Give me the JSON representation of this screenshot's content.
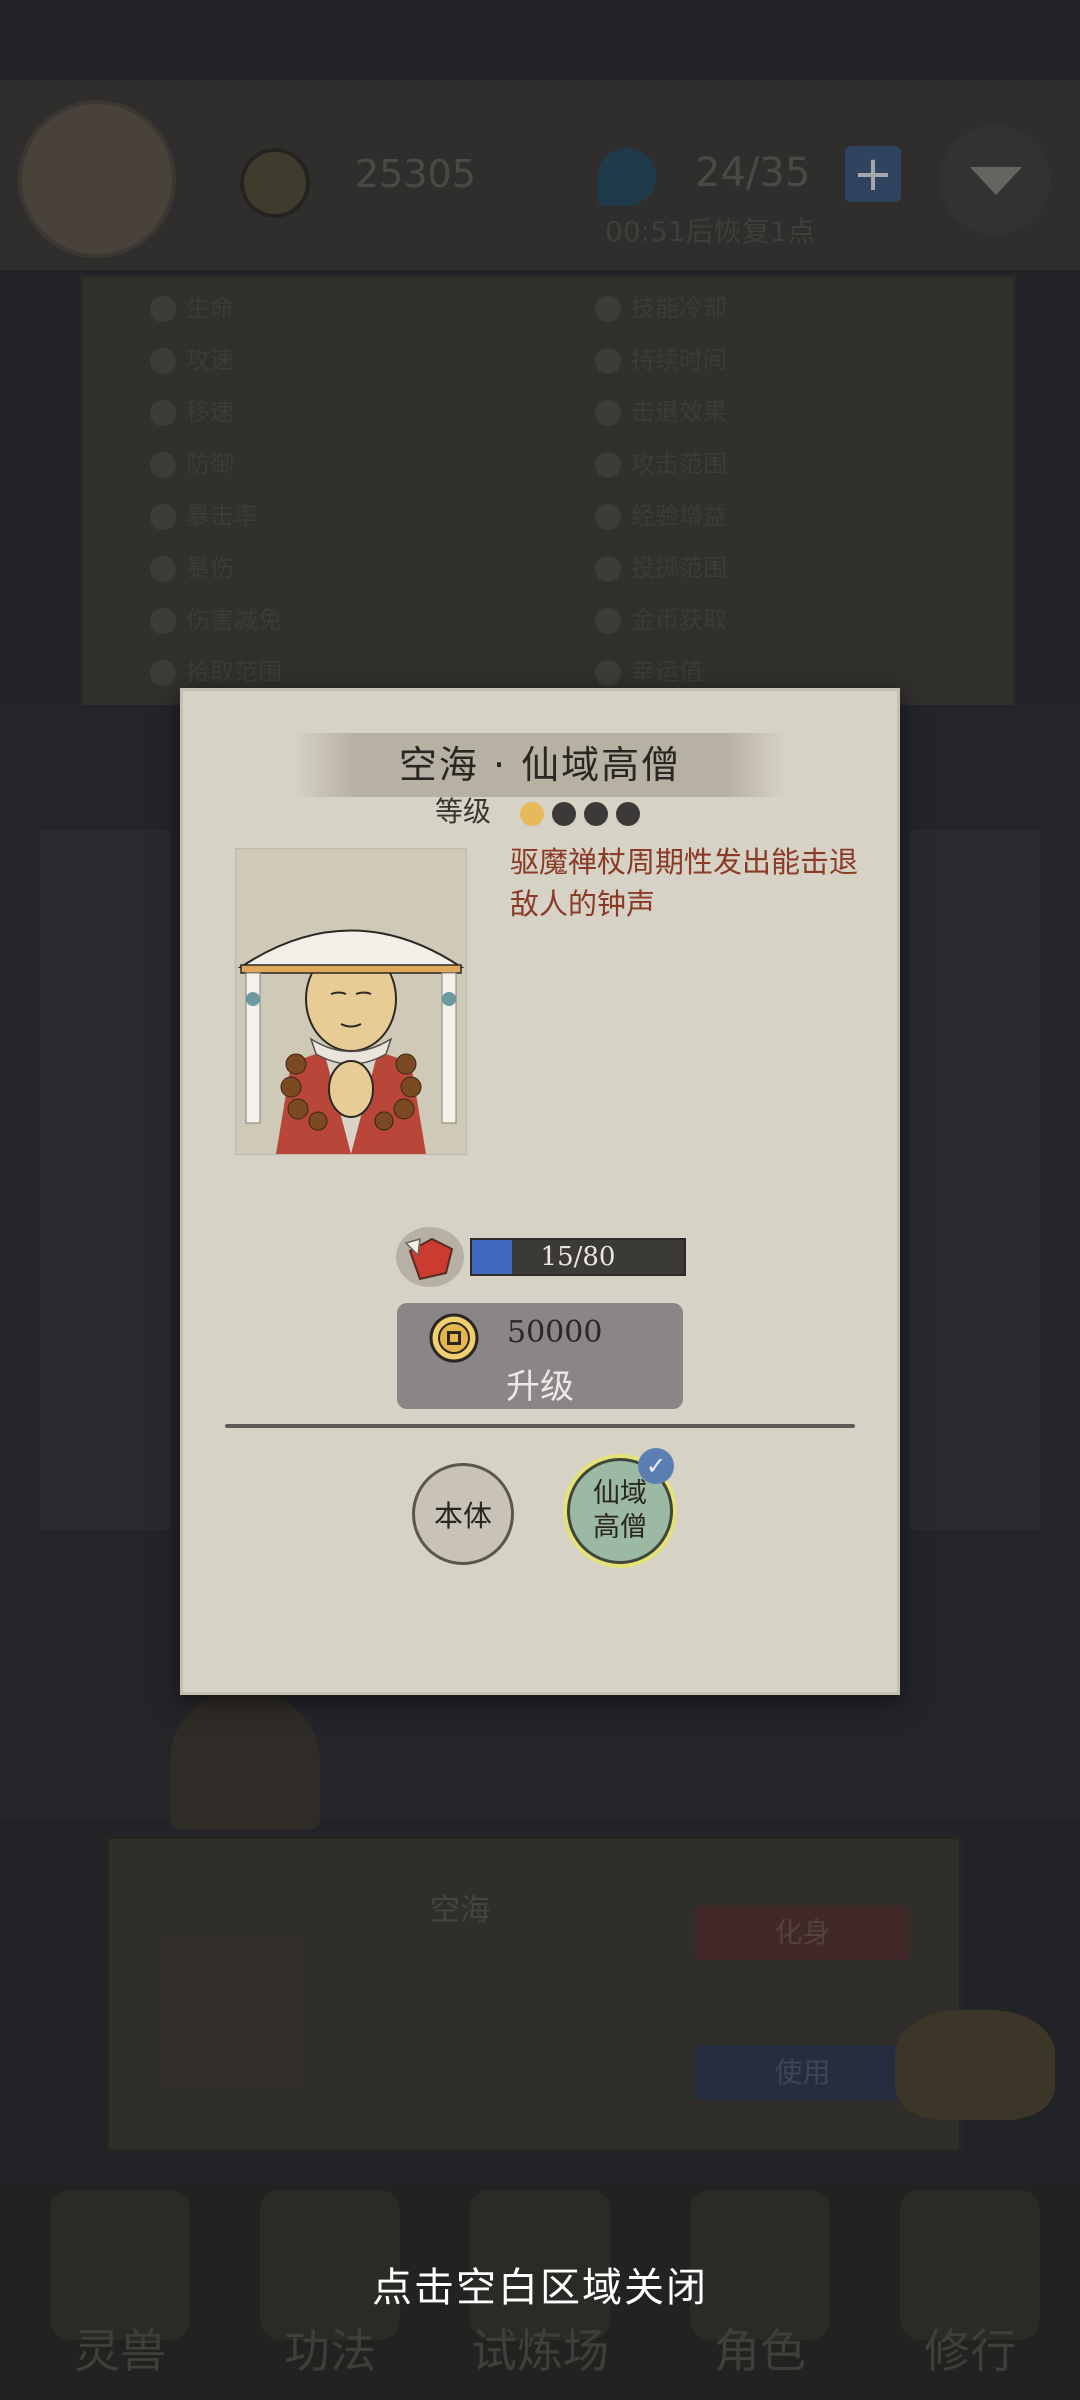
{
  "top_bar": {
    "coins": "25305",
    "stamina": "24/35",
    "plus_label": "+",
    "timer": "00:51后恢复1点"
  },
  "attributes": {
    "left": [
      "生命",
      "攻速",
      "移速",
      "防御",
      "暴击率",
      "暴伤",
      "伤害减免",
      "拾取范围"
    ],
    "right": [
      "技能冷却",
      "持续时间",
      "击退效果",
      "攻击范围",
      "经验增益",
      "投掷范围",
      "金币获取",
      "幸运值"
    ]
  },
  "bottom_card": {
    "title": "空海",
    "huashen_label": "化身",
    "use_label": "使用"
  },
  "bottom_nav": [
    "灵兽",
    "功法",
    "试炼场",
    "角色",
    "修行"
  ],
  "dialog": {
    "title": "空海 · 仙域高僧",
    "level_label": "等级",
    "level": {
      "current": 1,
      "max": 4
    },
    "description": "驱魔禅杖周期性发出能击退敌人的钟声",
    "progress": {
      "text": "15/80",
      "current": 15,
      "max": 80
    },
    "upgrade_cost": "50000",
    "upgrade_label": "升级",
    "forms": {
      "base_label": "本体",
      "immortal_line1": "仙域",
      "immortal_line2": "高僧"
    },
    "selected_form": "immortal"
  },
  "close_hint": "点击空白区域关闭",
  "colors": {
    "dialog_bg": "#d6d2c5",
    "description": "#8a3b27",
    "progress_fill": "#4169c0",
    "level_filled": "#e7b95a",
    "level_empty": "#3b3a38",
    "upgrade_bg": "#8a8587"
  },
  "icons": {
    "coin": "coin-icon",
    "stamina": "stamina-drop-icon",
    "shard": "character-shard-icon",
    "check": "check-icon"
  }
}
